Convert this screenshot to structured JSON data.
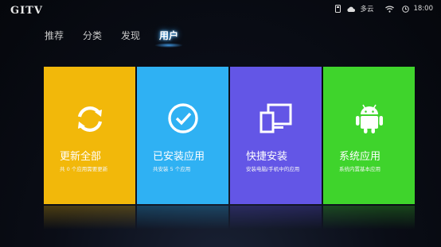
{
  "header": {
    "logo": "GITV",
    "weather": "多云",
    "time": "18:00"
  },
  "nav": {
    "tabs": [
      {
        "label": "推荐",
        "active": false
      },
      {
        "label": "分类",
        "active": false
      },
      {
        "label": "发现",
        "active": false
      },
      {
        "label": "用户",
        "active": true
      }
    ]
  },
  "tiles": [
    {
      "title": "更新全部",
      "subtitle": "共 0 个应用需要更新",
      "color": "#f2b80a",
      "icon": "refresh-icon"
    },
    {
      "title": "已安装应用",
      "subtitle": "共安装 5 个应用",
      "color": "#2fb1f3",
      "icon": "check-circle-icon"
    },
    {
      "title": "快捷安装",
      "subtitle": "安装电脑/手机中的应用",
      "color": "#6356e6",
      "icon": "devices-icon"
    },
    {
      "title": "系统应用",
      "subtitle": "系统内置基本应用",
      "color": "#3fd42c",
      "icon": "android-icon"
    }
  ],
  "colors": {
    "accent": "#3aa9ff",
    "background": "#0a0d16"
  }
}
